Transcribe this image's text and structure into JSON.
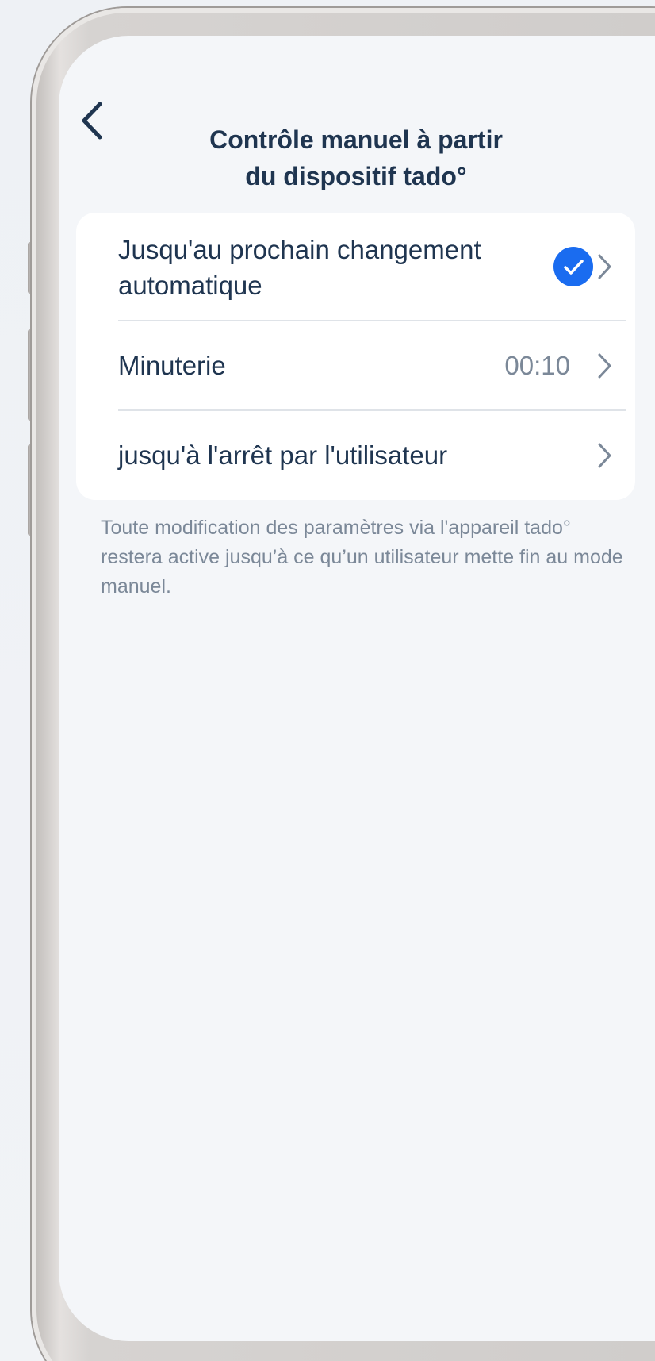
{
  "header": {
    "title_line1": "Contrôle manuel à partir",
    "title_line2": "du dispositif tado°",
    "back_icon": "chevron-left-icon"
  },
  "options": [
    {
      "label": "Jusqu'au prochain changement automatique",
      "value": "",
      "selected": true,
      "icon": "chevron-right-icon"
    },
    {
      "label": "Minuterie",
      "value": "00:10",
      "selected": false,
      "icon": "chevron-right-icon"
    },
    {
      "label": "jusqu'à l'arrêt par l'utilisateur",
      "value": "",
      "selected": false,
      "icon": "chevron-right-icon"
    }
  ],
  "note": "Toute modification des paramètres via l'appareil tado° restera active jusqu’à ce qu’un utilisateur mette fin au mode manuel.",
  "colors": {
    "accent": "#1a6cf0",
    "title": "#1f3550",
    "muted": "#7b8898",
    "background": "#f4f6f9",
    "card": "#ffffff"
  }
}
